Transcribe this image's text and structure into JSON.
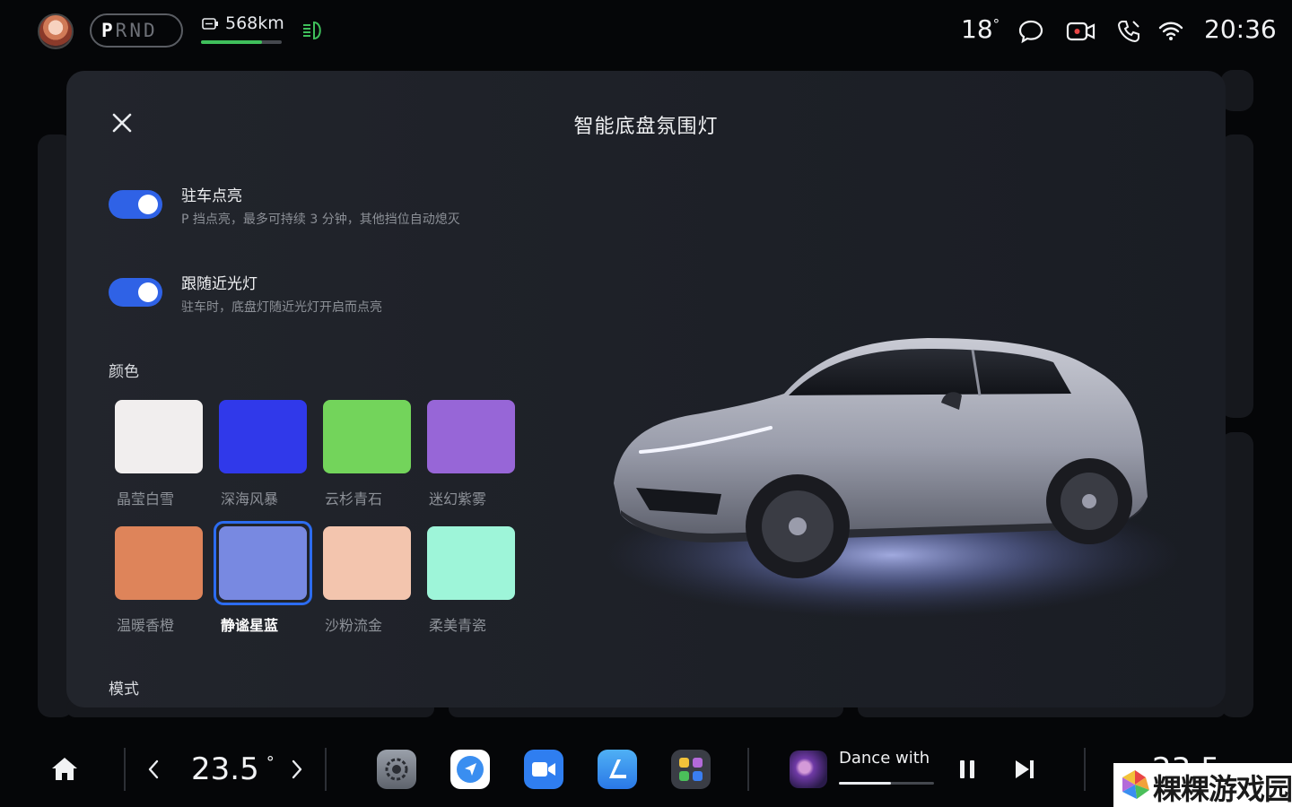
{
  "status_bar": {
    "gears": [
      "P",
      "R",
      "N",
      "D"
    ],
    "active_gear": "P",
    "range_text": "568km",
    "range_fraction": 0.75,
    "outside_temp": "18",
    "outside_temp_unit": "°",
    "icons": [
      "avatar",
      "battery-icon",
      "headlight-icon",
      "message-icon",
      "camera-icon",
      "phone-icon",
      "wifi-icon"
    ],
    "time": "20:36"
  },
  "modal": {
    "title": "智能底盘氛围灯",
    "options": [
      {
        "title": "驻车点亮",
        "desc": "P 挡点亮，最多可持续 3 分钟，其他挡位自动熄灭",
        "enabled": true
      },
      {
        "title": "跟随近光灯",
        "desc": "驻车时，底盘灯随近光灯开启而点亮",
        "enabled": true
      }
    ],
    "color_section_label": "颜色",
    "colors": [
      {
        "name": "晶莹白雪",
        "hex": "#f1eeee"
      },
      {
        "name": "深海风暴",
        "hex": "#3039ea"
      },
      {
        "name": "云杉青石",
        "hex": "#73d45b"
      },
      {
        "name": "迷幻紫雾",
        "hex": "#9766d7"
      },
      {
        "name": "温暖香橙",
        "hex": "#de845a"
      },
      {
        "name": "静谧星蓝",
        "hex": "#7889e1"
      },
      {
        "name": "沙粉流金",
        "hex": "#f3c5ae"
      },
      {
        "name": "柔美青瓷",
        "hex": "#9ef5d9"
      }
    ],
    "selected_color": "静谧星蓝",
    "mode_section_label": "模式"
  },
  "dock": {
    "cabin_temp": "23.5",
    "cabin_temp_unit": "°",
    "apps": [
      "settings-app",
      "navigation-app",
      "video-call-app",
      "seat-app",
      "app-launcher"
    ],
    "music": {
      "title": "Dance with",
      "progress": 0.55
    },
    "right_temp": "23.5"
  },
  "watermark": {
    "text": "粿粿游戏园"
  },
  "colors": {
    "accent": "#2f62e6",
    "selected_border": "#2c6cf0",
    "range_green": "#3fbf5b"
  }
}
